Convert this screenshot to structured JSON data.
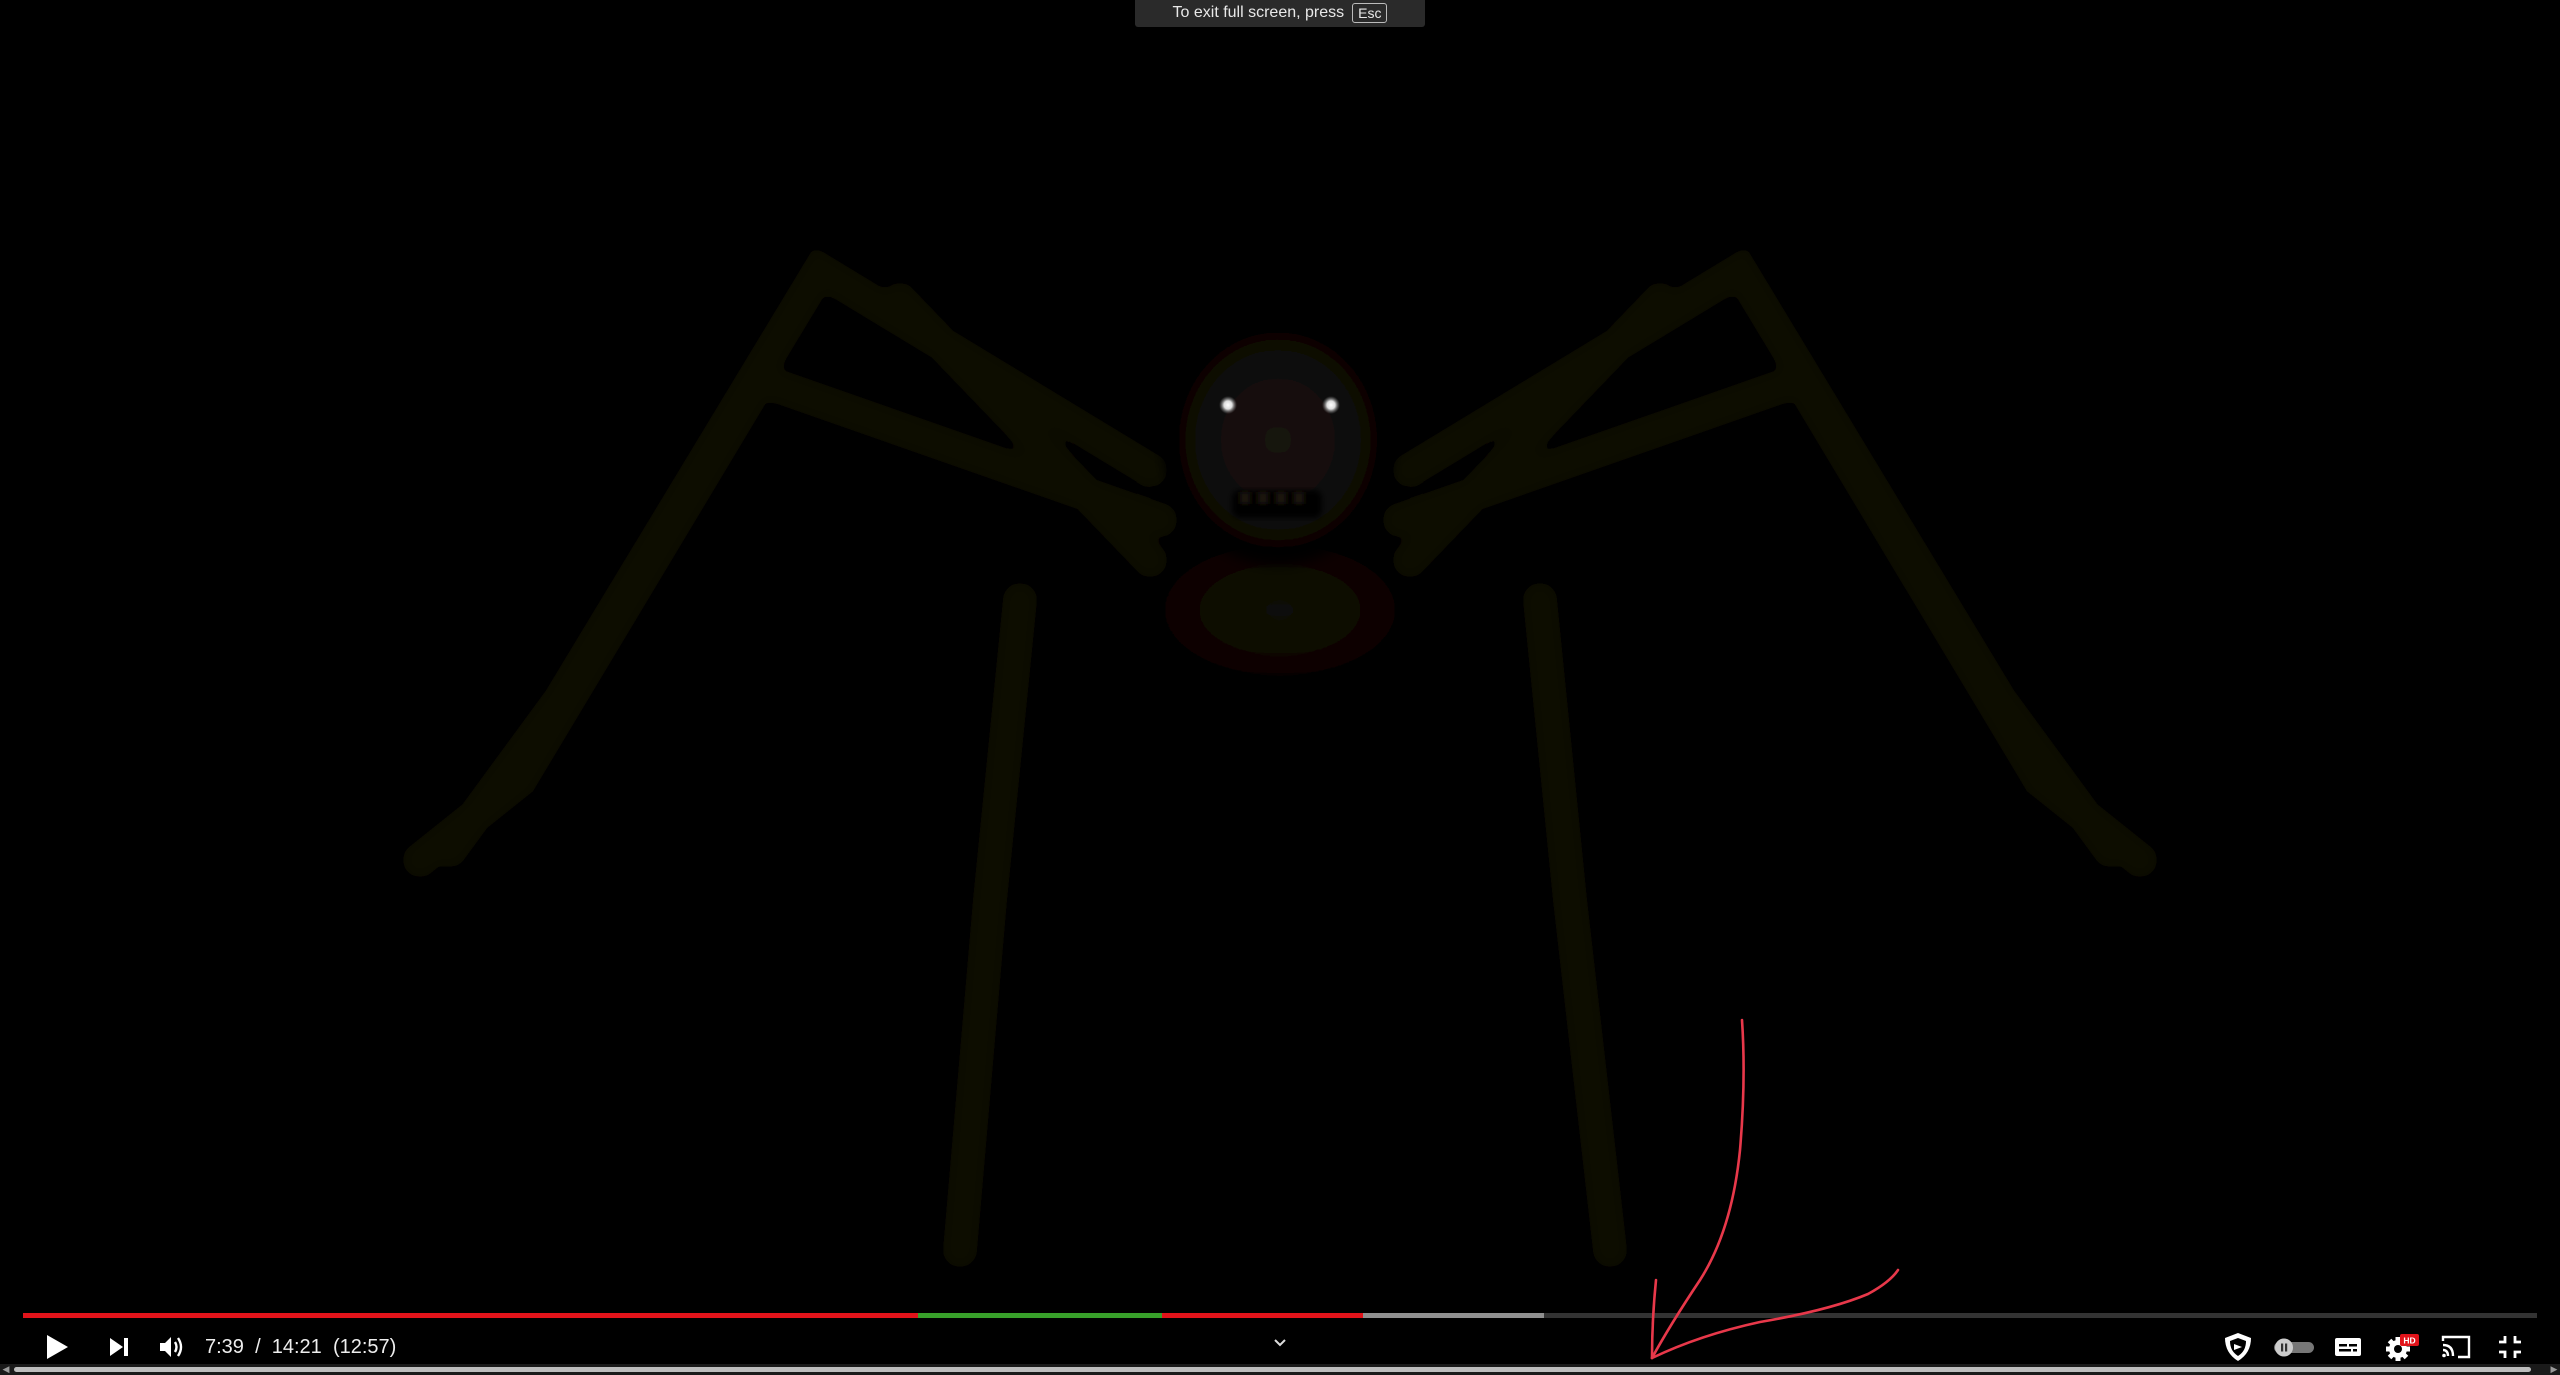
{
  "fullscreen_notice": {
    "text": "To exit full screen, press",
    "key": "Esc"
  },
  "player": {
    "current_time": "7:39",
    "separator": "/",
    "duration": "14:21",
    "adjusted_duration": "(12:57)",
    "progress_fraction": 0.533,
    "buffered_fraction": 0.605,
    "segments": [
      {
        "start": 0.0,
        "end": 0.356,
        "color": "#e1131a"
      },
      {
        "start": 0.356,
        "end": 0.453,
        "color": "#38a02a"
      },
      {
        "start": 0.453,
        "end": 0.533,
        "color": "#e1131a"
      }
    ],
    "colors": {
      "accent": "#ff0000",
      "sponsor_segment": "#00d400",
      "controls_icon": "#ffffff"
    },
    "hd_badge": "HD"
  },
  "icons": {
    "play": "play-icon",
    "next": "next-icon",
    "volume": "volume-icon",
    "chevron": "chevron-down-icon",
    "shield": "shield-icon",
    "autoplay": "autoplay-toggle-icon",
    "subtitles": "subtitles-icon",
    "settings": "settings-icon",
    "cast": "cast-icon",
    "exit_fullscreen": "exit-fullscreen-icon"
  }
}
